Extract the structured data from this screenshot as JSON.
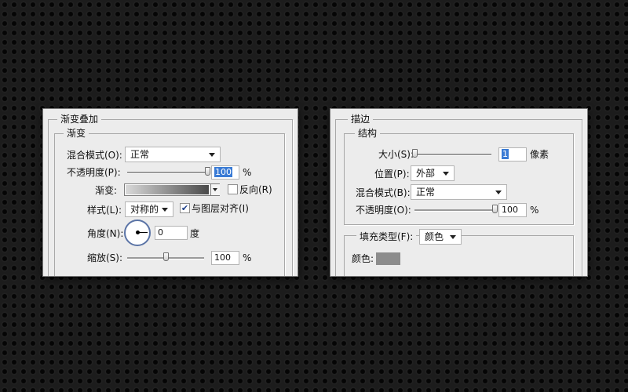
{
  "gradient_overlay": {
    "title": "渐变叠加",
    "group_title": "渐变",
    "blend_mode": {
      "label": "混合模式(O):",
      "value": "正常"
    },
    "opacity": {
      "label": "不透明度(P):",
      "value": "100",
      "unit": "%",
      "level": 1.0
    },
    "gradient": {
      "label": "渐变:",
      "colors": [
        "#d9d9d9",
        "#4a4a4a"
      ]
    },
    "reverse": {
      "label": "反向(R)",
      "checked": false
    },
    "style": {
      "label": "样式(L):",
      "value": "对称的"
    },
    "align": {
      "label": "与图层对齐(I)",
      "checked": true
    },
    "angle": {
      "label": "角度(N):",
      "value": "0",
      "unit": "度"
    },
    "scale": {
      "label": "缩放(S):",
      "value": "100",
      "unit": "%",
      "level": 0.5
    }
  },
  "stroke": {
    "title": "描边",
    "structure_title": "结构",
    "size": {
      "label": "大小(S):",
      "value": "1",
      "unit": "像素",
      "level": 0.0
    },
    "position": {
      "label": "位置(P):",
      "value": "外部"
    },
    "blend_mode": {
      "label": "混合模式(B):",
      "value": "正常"
    },
    "opacity": {
      "label": "不透明度(O):",
      "value": "100",
      "unit": "%",
      "level": 1.0
    },
    "fill_type": {
      "label": "填充类型(F):",
      "value": "颜色"
    },
    "color": {
      "label": "颜色:",
      "swatch": "#8c8c8c"
    }
  },
  "colors": {
    "panel_bg": "#ececec",
    "selection": "#3a7bd5",
    "angle_ring": "#5b74a6"
  }
}
